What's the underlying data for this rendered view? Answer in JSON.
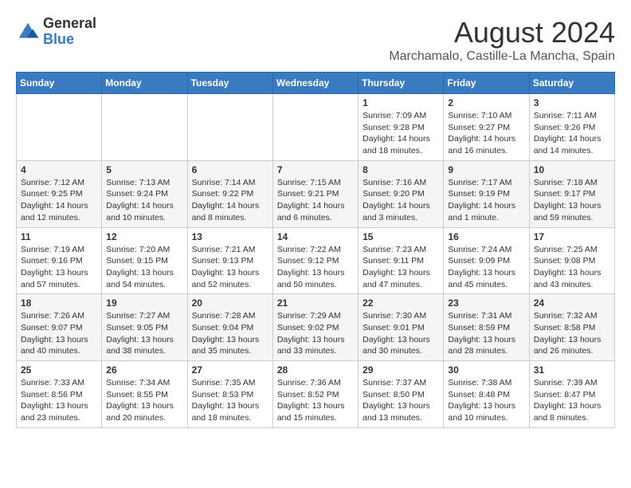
{
  "header": {
    "logo": {
      "general": "General",
      "blue": "Blue"
    },
    "title": "August 2024",
    "location": "Marchamalo, Castille-La Mancha, Spain"
  },
  "calendar": {
    "headers": [
      "Sunday",
      "Monday",
      "Tuesday",
      "Wednesday",
      "Thursday",
      "Friday",
      "Saturday"
    ],
    "weeks": [
      [
        {
          "day": "",
          "info": ""
        },
        {
          "day": "",
          "info": ""
        },
        {
          "day": "",
          "info": ""
        },
        {
          "day": "",
          "info": ""
        },
        {
          "day": "1",
          "info": "Sunrise: 7:09 AM\nSunset: 9:28 PM\nDaylight: 14 hours\nand 18 minutes."
        },
        {
          "day": "2",
          "info": "Sunrise: 7:10 AM\nSunset: 9:27 PM\nDaylight: 14 hours\nand 16 minutes."
        },
        {
          "day": "3",
          "info": "Sunrise: 7:11 AM\nSunset: 9:26 PM\nDaylight: 14 hours\nand 14 minutes."
        }
      ],
      [
        {
          "day": "4",
          "info": "Sunrise: 7:12 AM\nSunset: 9:25 PM\nDaylight: 14 hours\nand 12 minutes."
        },
        {
          "day": "5",
          "info": "Sunrise: 7:13 AM\nSunset: 9:24 PM\nDaylight: 14 hours\nand 10 minutes."
        },
        {
          "day": "6",
          "info": "Sunrise: 7:14 AM\nSunset: 9:22 PM\nDaylight: 14 hours\nand 8 minutes."
        },
        {
          "day": "7",
          "info": "Sunrise: 7:15 AM\nSunset: 9:21 PM\nDaylight: 14 hours\nand 6 minutes."
        },
        {
          "day": "8",
          "info": "Sunrise: 7:16 AM\nSunset: 9:20 PM\nDaylight: 14 hours\nand 3 minutes."
        },
        {
          "day": "9",
          "info": "Sunrise: 7:17 AM\nSunset: 9:19 PM\nDaylight: 14 hours\nand 1 minute."
        },
        {
          "day": "10",
          "info": "Sunrise: 7:18 AM\nSunset: 9:17 PM\nDaylight: 13 hours\nand 59 minutes."
        }
      ],
      [
        {
          "day": "11",
          "info": "Sunrise: 7:19 AM\nSunset: 9:16 PM\nDaylight: 13 hours\nand 57 minutes."
        },
        {
          "day": "12",
          "info": "Sunrise: 7:20 AM\nSunset: 9:15 PM\nDaylight: 13 hours\nand 54 minutes."
        },
        {
          "day": "13",
          "info": "Sunrise: 7:21 AM\nSunset: 9:13 PM\nDaylight: 13 hours\nand 52 minutes."
        },
        {
          "day": "14",
          "info": "Sunrise: 7:22 AM\nSunset: 9:12 PM\nDaylight: 13 hours\nand 50 minutes."
        },
        {
          "day": "15",
          "info": "Sunrise: 7:23 AM\nSunset: 9:11 PM\nDaylight: 13 hours\nand 47 minutes."
        },
        {
          "day": "16",
          "info": "Sunrise: 7:24 AM\nSunset: 9:09 PM\nDaylight: 13 hours\nand 45 minutes."
        },
        {
          "day": "17",
          "info": "Sunrise: 7:25 AM\nSunset: 9:08 PM\nDaylight: 13 hours\nand 43 minutes."
        }
      ],
      [
        {
          "day": "18",
          "info": "Sunrise: 7:26 AM\nSunset: 9:07 PM\nDaylight: 13 hours\nand 40 minutes."
        },
        {
          "day": "19",
          "info": "Sunrise: 7:27 AM\nSunset: 9:05 PM\nDaylight: 13 hours\nand 38 minutes."
        },
        {
          "day": "20",
          "info": "Sunrise: 7:28 AM\nSunset: 9:04 PM\nDaylight: 13 hours\nand 35 minutes."
        },
        {
          "day": "21",
          "info": "Sunrise: 7:29 AM\nSunset: 9:02 PM\nDaylight: 13 hours\nand 33 minutes."
        },
        {
          "day": "22",
          "info": "Sunrise: 7:30 AM\nSunset: 9:01 PM\nDaylight: 13 hours\nand 30 minutes."
        },
        {
          "day": "23",
          "info": "Sunrise: 7:31 AM\nSunset: 8:59 PM\nDaylight: 13 hours\nand 28 minutes."
        },
        {
          "day": "24",
          "info": "Sunrise: 7:32 AM\nSunset: 8:58 PM\nDaylight: 13 hours\nand 26 minutes."
        }
      ],
      [
        {
          "day": "25",
          "info": "Sunrise: 7:33 AM\nSunset: 8:56 PM\nDaylight: 13 hours\nand 23 minutes."
        },
        {
          "day": "26",
          "info": "Sunrise: 7:34 AM\nSunset: 8:55 PM\nDaylight: 13 hours\nand 20 minutes."
        },
        {
          "day": "27",
          "info": "Sunrise: 7:35 AM\nSunset: 8:53 PM\nDaylight: 13 hours\nand 18 minutes."
        },
        {
          "day": "28",
          "info": "Sunrise: 7:36 AM\nSunset: 8:52 PM\nDaylight: 13 hours\nand 15 minutes."
        },
        {
          "day": "29",
          "info": "Sunrise: 7:37 AM\nSunset: 8:50 PM\nDaylight: 13 hours\nand 13 minutes."
        },
        {
          "day": "30",
          "info": "Sunrise: 7:38 AM\nSunset: 8:48 PM\nDaylight: 13 hours\nand 10 minutes."
        },
        {
          "day": "31",
          "info": "Sunrise: 7:39 AM\nSunset: 8:47 PM\nDaylight: 13 hours\nand 8 minutes."
        }
      ]
    ]
  }
}
